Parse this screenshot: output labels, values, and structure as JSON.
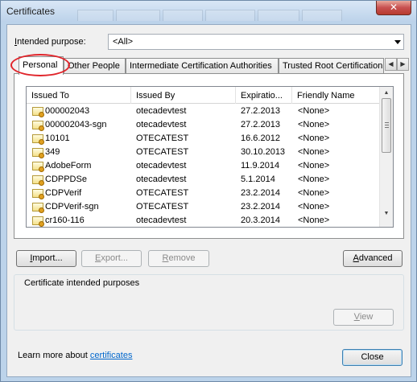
{
  "window": {
    "title": "Certificates",
    "close_glyph": "✕"
  },
  "purpose": {
    "label_prefix": "",
    "label_accel": "I",
    "label_rest": "ntended purpose:",
    "value": "<All>"
  },
  "tabs": [
    {
      "label": "Personal",
      "active": true
    },
    {
      "label": "Other People",
      "active": false
    },
    {
      "label": "Intermediate Certification Authorities",
      "active": false
    },
    {
      "label": "Trusted Root Certification",
      "active": false
    }
  ],
  "tab_scroll": {
    "left": "◀",
    "right": "▶"
  },
  "list": {
    "columns": [
      "Issued To",
      "Issued By",
      "Expiratio...",
      "Friendly Name"
    ],
    "rows": [
      [
        "000002043",
        "otecadevtest",
        "27.2.2013",
        "<None>"
      ],
      [
        "000002043-sgn",
        "otecadevtest",
        "27.2.2013",
        "<None>"
      ],
      [
        "10101",
        "OTECATEST",
        "16.6.2012",
        "<None>"
      ],
      [
        "349",
        "OTECATEST",
        "30.10.2013",
        "<None>"
      ],
      [
        "AdobeForm",
        "otecadevtest",
        "11.9.2014",
        "<None>"
      ],
      [
        "CDPPDSe",
        "otecadevtest",
        "5.1.2014",
        "<None>"
      ],
      [
        "CDPVerif",
        "OTECATEST",
        "23.2.2014",
        "<None>"
      ],
      [
        "CDPVerif-sgn",
        "OTECATEST",
        "23.2.2014",
        "<None>"
      ],
      [
        "cr160-116",
        "otecadevtest",
        "20.3.2014",
        "<None>"
      ]
    ],
    "scroll_up": "▲",
    "scroll_down": "▼"
  },
  "buttons": {
    "import": {
      "accel": "I",
      "rest": "mport..."
    },
    "export": {
      "accel": "E",
      "rest": "xport..."
    },
    "remove": {
      "accel": "R",
      "rest": "emove"
    },
    "advanced": {
      "accel": "A",
      "rest": "dvanced"
    },
    "view": {
      "accel": "V",
      "rest": "iew"
    },
    "close": "Close"
  },
  "intended_purposes": {
    "label": "Certificate intended purposes"
  },
  "learn_more": {
    "text": "Learn more about ",
    "link": "certificates"
  },
  "colors": {
    "frame": "#bcd3ea",
    "close_button": "#c75050",
    "highlight_ring": "#e0242a",
    "link": "#0066cc"
  }
}
